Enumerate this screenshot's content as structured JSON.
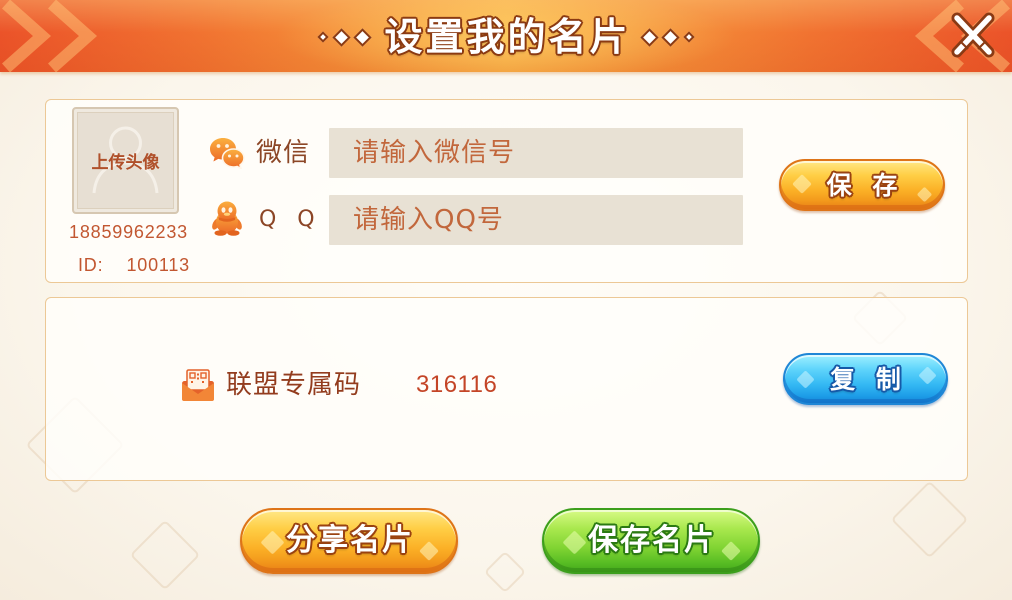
{
  "header": {
    "title": "设置我的名片"
  },
  "profile": {
    "avatar_label": "上传头像",
    "phone": "18859962233",
    "id_label": "ID:",
    "id_value": "100113"
  },
  "contacts": {
    "wechat": {
      "label": "微信",
      "placeholder": "请输入微信号",
      "value": ""
    },
    "qq": {
      "label": "Q Q",
      "placeholder": "请输入QQ号",
      "value": ""
    },
    "save_label": "保 存"
  },
  "alliance": {
    "label": "联盟专属码",
    "code": "316116",
    "copy_label": "复 制"
  },
  "footer": {
    "share_label": "分享名片",
    "save_card_label": "保存名片"
  },
  "icons": {
    "close": "close-icon",
    "avatar": "avatar-placeholder-icon",
    "wechat": "wechat-icon",
    "qq": "qq-penguin-icon",
    "alliance_code": "qr-code-envelope-icon",
    "title_ornament": "diamond-ornament-icon"
  },
  "colors": {
    "header_orange": "#f17331",
    "header_gold": "#f9ab42",
    "panel_border": "#ecc896",
    "label_brown": "#8c4626",
    "placeholder_orange": "#c2673c",
    "code_red": "#c44527",
    "button_orange": "#fbb026",
    "button_blue": "#33b8f3",
    "button_green": "#7fd332"
  }
}
